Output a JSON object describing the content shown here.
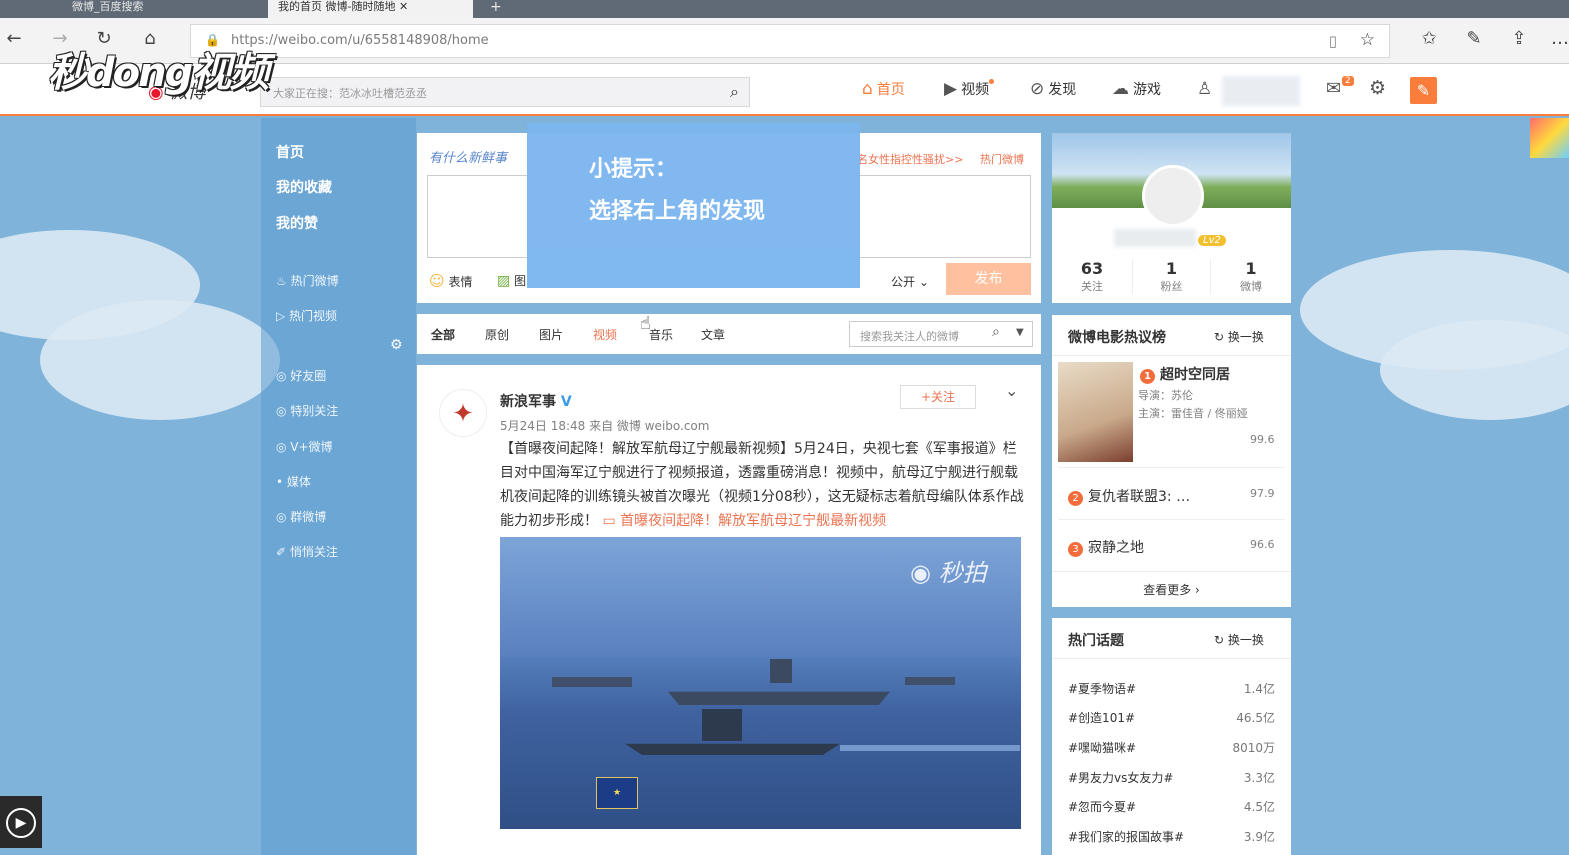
{
  "browser": {
    "tabs": [
      "微博_百度搜索",
      "我的首页 微博-随时随地"
    ],
    "url": "https://weibo.com/u/6558148908/home"
  },
  "watermark": {
    "logo": "秒dong视频"
  },
  "weibo_nav": {
    "brand": "微博",
    "search_placeholder": "大家正在搜：范冰冰吐槽范丞丞",
    "items": [
      {
        "label": "首页",
        "icon": "home-icon"
      },
      {
        "label": "视频",
        "icon": "video-icon"
      },
      {
        "label": "发现",
        "icon": "compass-icon"
      },
      {
        "label": "游戏",
        "icon": "gamepad-icon"
      }
    ],
    "mail_badge": "2"
  },
  "left_nav": {
    "main": [
      "首页",
      "我的收藏",
      "我的赞"
    ],
    "hot": [
      "热门微博",
      "热门视频"
    ],
    "groups": [
      "好友圈",
      "特别关注",
      "V+微博",
      "媒体",
      "群微博",
      "悄悄关注"
    ]
  },
  "composer": {
    "prompt": "有什么新鲜事",
    "hot_link": "名女性指控性骚扰>>",
    "hot_tag": "热门微博",
    "emoji": "表情",
    "image": "图",
    "visibility": "公开",
    "publish": "发布"
  },
  "tip": {
    "line1": "小提示：",
    "line2": "选择右上角的发现"
  },
  "feed_tabs": {
    "tabs": [
      "全部",
      "原创",
      "图片",
      "视频",
      "音乐",
      "文章"
    ],
    "search_placeholder": "搜索我关注人的微博"
  },
  "post": {
    "author": "新浪军事",
    "follow": "+关注",
    "meta": "5月24日 18:48 来自 微博 weibo.com",
    "text": "【首曝夜间起降！解放军航母辽宁舰最新视频】5月24日，央视七套《军事报道》栏目对中国海军辽宁舰进行了视频报道，透露重磅消息！视频中，航母辽宁舰进行舰载机夜间起降的训练镜头被首次曝光（视频1分08秒），这无疑标志着航母编队体系作战能力初步形成！",
    "link": "首曝夜间起降！解放军航母辽宁舰最新视频",
    "video_watermark": "秒拍"
  },
  "profile": {
    "level": "Lv2",
    "stats": [
      {
        "num": "63",
        "label": "关注"
      },
      {
        "num": "1",
        "label": "粉丝"
      },
      {
        "num": "1",
        "label": "微博"
      }
    ]
  },
  "movies": {
    "title": "微博电影热议榜",
    "refresh": "换一换",
    "top": {
      "rank": "1",
      "name": "超时空同居",
      "director": "导演：苏伦",
      "cast": "主演：雷佳音 / 佟丽娅",
      "score": "99.6"
    },
    "list": [
      {
        "rank": "2",
        "name": "复仇者联盟3: …",
        "score": "97.9"
      },
      {
        "rank": "3",
        "name": "寂静之地",
        "score": "96.6"
      }
    ],
    "more": "查看更多 ›"
  },
  "topics": {
    "title": "热门话题",
    "refresh": "换一换",
    "items": [
      {
        "name": "#夏季物语#",
        "count": "1.4亿"
      },
      {
        "name": "#创造101#",
        "count": "46.5亿"
      },
      {
        "name": "#嘿呦猫咪#",
        "count": "8010万"
      },
      {
        "name": "#男友力vs女友力#",
        "count": "3.3亿"
      },
      {
        "name": "#忽而今夏#",
        "count": "4.5亿"
      },
      {
        "name": "#我们家的报国故事#",
        "count": "3.9亿"
      }
    ]
  }
}
